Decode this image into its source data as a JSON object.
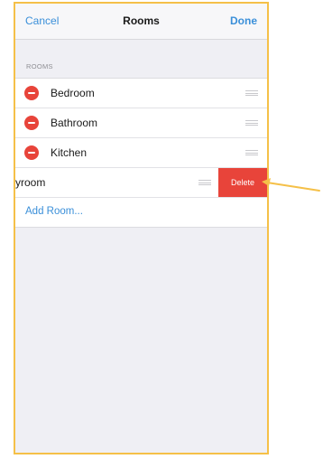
{
  "navbar": {
    "cancel_label": "Cancel",
    "title": "Rooms",
    "done_label": "Done"
  },
  "section": {
    "header": "ROOMS"
  },
  "rooms": [
    {
      "label": "Bedroom"
    },
    {
      "label": "Bathroom"
    },
    {
      "label": "Kitchen"
    }
  ],
  "swiped_row": {
    "label": "yroom",
    "delete_label": "Delete"
  },
  "add_room": {
    "label": "Add Room..."
  },
  "colors": {
    "accent": "#3a8fd9",
    "destructive": "#e8443a",
    "annotation": "#f5c048"
  }
}
